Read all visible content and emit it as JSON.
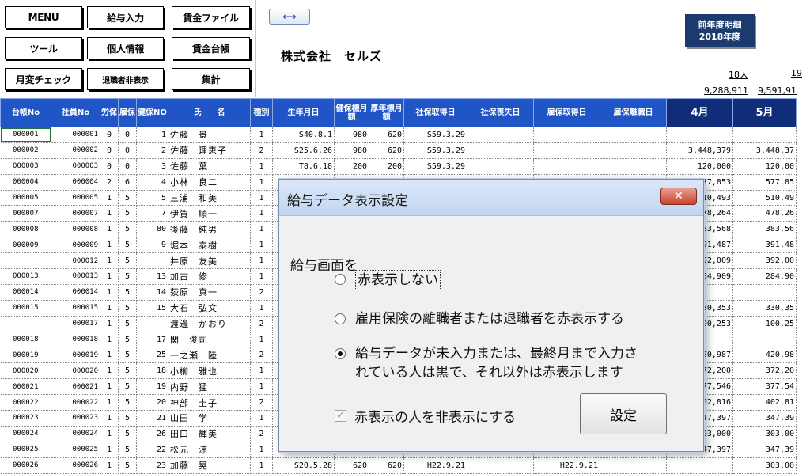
{
  "toolbar": {
    "menu": "MENU",
    "salary_input": "給与入力",
    "wage_file": "賃金ファイル",
    "tools": "ツール",
    "personal_info": "個人情報",
    "wage_ledger": "賃金台帳",
    "monthly_change_check": "月変チェック",
    "show_retirees": "退職者非表示",
    "totals": "集計"
  },
  "header": {
    "resize_glyph": "⟷",
    "company": "株式会社　セルズ",
    "badge_line1": "前年度明細",
    "badge_line2": "2018年度",
    "count_april": "18人",
    "count_may": "19",
    "total_april": "9,288,911",
    "total_may": "9,591,91"
  },
  "columns": [
    "台帳No",
    "社員No",
    "労保",
    "雇保",
    "健保NO",
    "氏　　名",
    "種別",
    "生年月日",
    "健保標月額",
    "厚年標月額",
    "社保取得日",
    "社保喪失日",
    "雇保取得日",
    "雇保離職日",
    "4月",
    "5月"
  ],
  "rows": [
    [
      "000001",
      "000001",
      "0",
      "0",
      "1",
      "佐藤　景",
      "1",
      "S40.8.1",
      "980",
      "620",
      "S59.3.29",
      "",
      "",
      "",
      "",
      ""
    ],
    [
      "000002",
      "000002",
      "0",
      "0",
      "2",
      "佐藤　理恵子",
      "2",
      "S25.6.26",
      "980",
      "620",
      "S59.3.29",
      "",
      "",
      "",
      "3,448,379",
      "3,448,37"
    ],
    [
      "000003",
      "000003",
      "0",
      "0",
      "3",
      "佐藤　葉",
      "1",
      "T8.6.18",
      "200",
      "200",
      "S59.3.29",
      "",
      "",
      "",
      "120,000",
      "120,00"
    ],
    [
      "000004",
      "000004",
      "2",
      "6",
      "4",
      "小林　良二",
      "1",
      "",
      "",
      "",
      "",
      "",
      "",
      "",
      "577,853",
      "577,85"
    ],
    [
      "000005",
      "000005",
      "1",
      "5",
      "5",
      "三浦　和美",
      "1",
      "",
      "",
      "",
      "",
      "",
      "",
      "",
      "510,493",
      "510,49"
    ],
    [
      "000007",
      "000007",
      "1",
      "5",
      "7",
      "伊賀　順一",
      "1",
      "",
      "",
      "",
      "",
      "",
      "",
      "",
      "478,264",
      "478,26"
    ],
    [
      "000008",
      "000008",
      "1",
      "5",
      "80",
      "後藤　純男",
      "1",
      "",
      "",
      "",
      "",
      "",
      "",
      "",
      "383,568",
      "383,56"
    ],
    [
      "000009",
      "000009",
      "1",
      "5",
      "9",
      "堀本　泰樹",
      "1",
      "",
      "",
      "",
      "",
      "",
      "",
      "",
      "391,487",
      "391,48"
    ],
    [
      "",
      "000012",
      "1",
      "5",
      "",
      "井原　友美",
      "1",
      "",
      "",
      "",
      "",
      "",
      "",
      "",
      "392,009",
      "392,00"
    ],
    [
      "000013",
      "000013",
      "1",
      "5",
      "13",
      "加古　修",
      "1",
      "",
      "",
      "",
      "",
      "",
      "",
      "",
      "284,909",
      "284,90"
    ],
    [
      "000014",
      "000014",
      "1",
      "5",
      "14",
      "荻原　真一",
      "2",
      "",
      "",
      "",
      "",
      "",
      "",
      "",
      "",
      ""
    ],
    [
      "000015",
      "000015",
      "1",
      "5",
      "15",
      "大石　弘文",
      "1",
      "",
      "",
      "",
      "",
      "",
      "",
      "",
      "330,353",
      "330,35"
    ],
    [
      "",
      "000017",
      "1",
      "5",
      "",
      "渡邊　かおり",
      "2",
      "",
      "",
      "",
      "",
      "",
      "",
      "",
      "100,253",
      "100,25"
    ],
    [
      "000018",
      "000018",
      "1",
      "5",
      "17",
      "関　俊司",
      "1",
      "",
      "",
      "",
      "",
      "",
      "",
      "",
      "",
      ""
    ],
    [
      "000019",
      "000019",
      "1",
      "5",
      "25",
      "一之瀬　陸",
      "2",
      "",
      "",
      "",
      "",
      "",
      "",
      "",
      "420,987",
      "420,98"
    ],
    [
      "000020",
      "000020",
      "1",
      "5",
      "18",
      "小柳　雅也",
      "1",
      "",
      "",
      "",
      "",
      "",
      "",
      "",
      "372,200",
      "372,20"
    ],
    [
      "000021",
      "000021",
      "1",
      "5",
      "19",
      "内野　猛",
      "1",
      "",
      "",
      "",
      "",
      "",
      "",
      "",
      "377,546",
      "377,54"
    ],
    [
      "000022",
      "000022",
      "1",
      "5",
      "20",
      "神部　圭子",
      "2",
      "",
      "",
      "",
      "",
      "",
      "",
      "",
      "402,816",
      "402,81"
    ],
    [
      "000023",
      "000023",
      "1",
      "5",
      "21",
      "山田　学",
      "1",
      "",
      "",
      "",
      "",
      "",
      "",
      "",
      "347,397",
      "347,39"
    ],
    [
      "000024",
      "000024",
      "1",
      "5",
      "26",
      "田口　輝美",
      "2",
      "",
      "",
      "",
      "",
      "",
      "",
      "",
      "303,000",
      "303,00"
    ],
    [
      "000025",
      "000025",
      "1",
      "5",
      "22",
      "松元　涼",
      "1",
      "",
      "",
      "",
      "",
      "",
      "",
      "",
      "347,397",
      "347,39"
    ],
    [
      "000026",
      "000026",
      "1",
      "5",
      "23",
      "加藤　晃",
      "1",
      "S20.5.28",
      "620",
      "620",
      "H22.9.21",
      "",
      "H22.9.21",
      "",
      "",
      "303,00"
    ]
  ],
  "dialog": {
    "title": "給与データ表示設定",
    "close_glyph": "✕",
    "label": "給与画面を",
    "option1": "赤表示しない",
    "option2": "雇用保険の離職者または退職者を赤表示する",
    "option3_line1": "給与データが未入力または、最終月まで入力さ",
    "option3_line2": "れている人は黒で、それ以外は赤表示します",
    "checkbox_label": "赤表示の人を非表示にする",
    "checkbox_glyph": "✓",
    "apply": "設定"
  }
}
